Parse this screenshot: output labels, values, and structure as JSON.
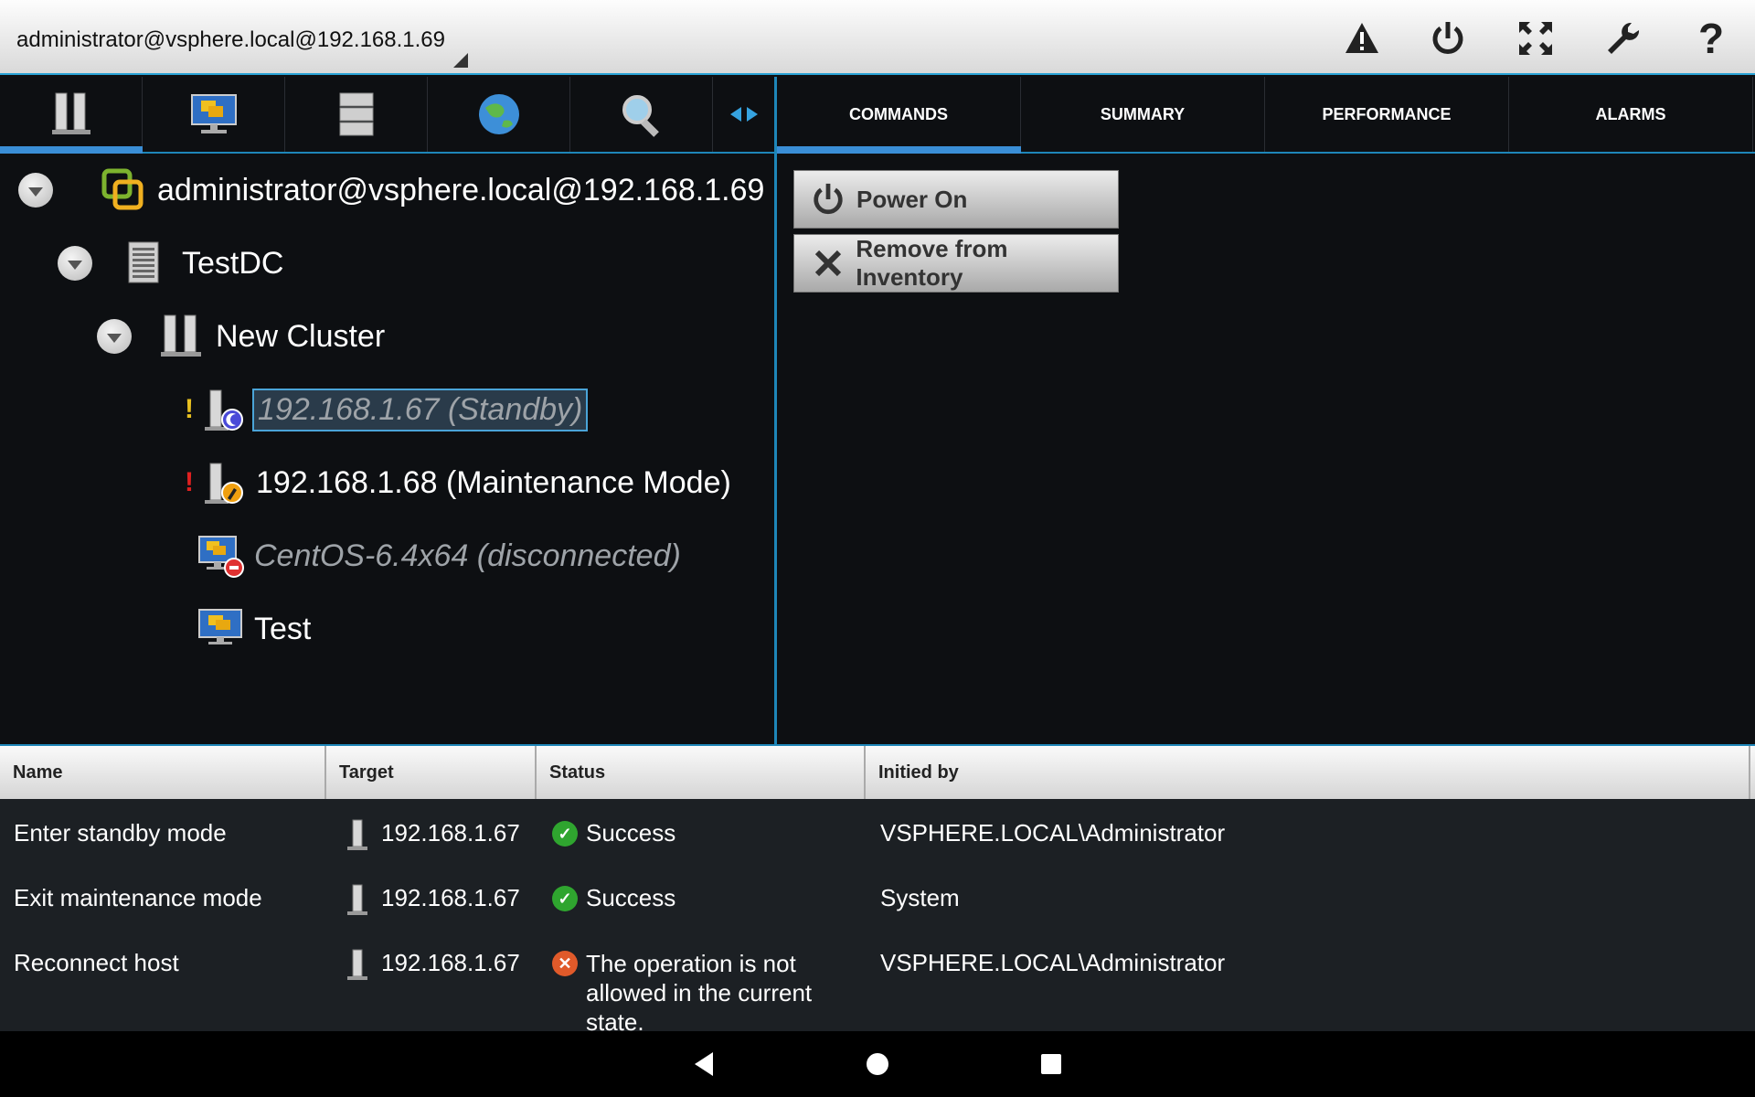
{
  "header": {
    "connection": "administrator@vsphere.local@192.168.1.69",
    "icons": [
      "alert-icon",
      "power-icon",
      "fullscreen-icon",
      "settings-wrench-icon",
      "help-icon"
    ]
  },
  "left_tabs": [
    "hosts-clusters-tab",
    "vms-tab",
    "datastores-tab",
    "networks-tab",
    "search-tab"
  ],
  "tree": {
    "root": "administrator@vsphere.local@192.168.1.69",
    "datacenter": "TestDC",
    "cluster": "New Cluster",
    "host_standby": "192.168.1.67 (Standby)",
    "host_maint": "192.168.1.68 (Maintenance Mode)",
    "vm_disconnected": "CentOS-6.4x64 (disconnected)",
    "vm_test": "Test"
  },
  "right_tabs": {
    "commands": "COMMANDS",
    "summary": "SUMMARY",
    "performance": "PERFORMANCE",
    "alarms": "ALARMS"
  },
  "commands": {
    "power_on": "Power On",
    "remove": "Remove from Inventory"
  },
  "tasks": {
    "headers": {
      "name": "Name",
      "target": "Target",
      "status": "Status",
      "initiated": "Initied by"
    },
    "rows": [
      {
        "name": "Enter standby mode",
        "target": "192.168.1.67",
        "status": "Success",
        "initiated": "VSPHERE.LOCAL\\Administrator",
        "ok": true
      },
      {
        "name": "Exit maintenance mode",
        "target": "192.168.1.67",
        "status": "Success",
        "initiated": "System",
        "ok": true
      },
      {
        "name": "Reconnect host",
        "target": "192.168.1.67",
        "status": "The operation is not allowed in the current state.",
        "initiated": "VSPHERE.LOCAL\\Administrator",
        "ok": false
      }
    ]
  },
  "colors": {
    "accent": "#1e86b8",
    "success": "#2fa52f",
    "error": "#e05a2a"
  }
}
